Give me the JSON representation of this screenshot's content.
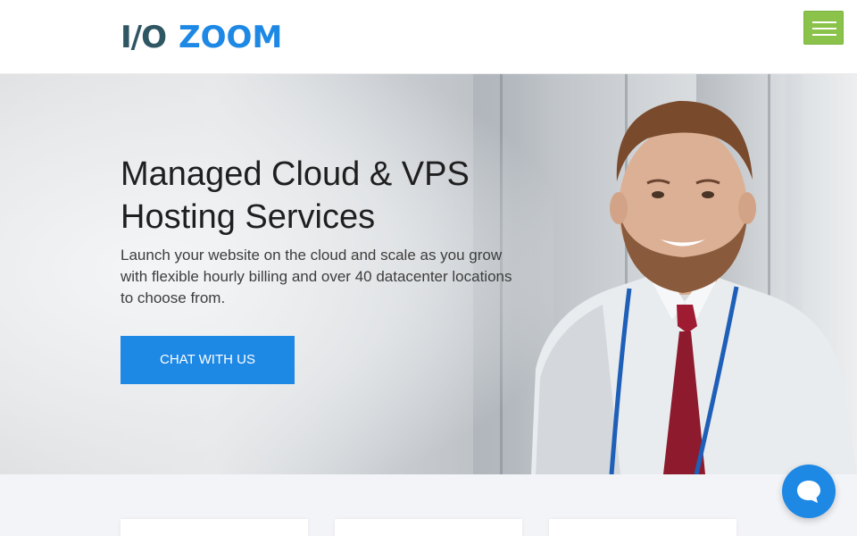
{
  "header": {
    "logo_io": "I/O",
    "logo_zoom": "ZOOM",
    "menu_icon": "hamburger-menu-icon"
  },
  "hero": {
    "title": "Managed Cloud & VPS Hosting Services",
    "subtitle": "Launch your website on the cloud and scale as you grow with flexible hourly billing and over 40 datacenter locations to choose from.",
    "cta_label": "CHAT WITH US"
  },
  "chat_widget": {
    "icon": "chat-bubble-icon"
  },
  "colors": {
    "brand_blue": "#1e88e5",
    "logo_dark": "#2f5663",
    "menu_green": "#8bc34a"
  }
}
